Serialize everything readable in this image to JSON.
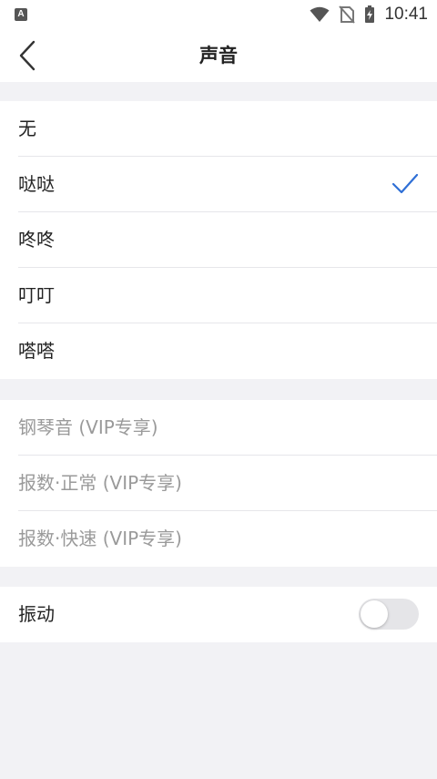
{
  "status_bar": {
    "time": "10:41",
    "icons": [
      "app-notification-icon",
      "wifi-icon",
      "no-sim-icon",
      "battery-charging-icon"
    ]
  },
  "header": {
    "title": "声音",
    "back_icon": "chevron-left-icon"
  },
  "sound_options": [
    {
      "label": "无",
      "selected": false
    },
    {
      "label": "哒哒",
      "selected": true
    },
    {
      "label": "咚咚",
      "selected": false
    },
    {
      "label": "叮叮",
      "selected": false
    },
    {
      "label": "嗒嗒",
      "selected": false
    }
  ],
  "vip_options": [
    {
      "label": "钢琴音 (VIP专享)"
    },
    {
      "label": "报数·正常 (VIP专享)"
    },
    {
      "label": "报数·快速 (VIP专享)"
    }
  ],
  "vibration": {
    "label": "振动",
    "enabled": false
  },
  "colors": {
    "accent": "#2f6fd6",
    "background": "#f2f2f5",
    "disabled_text": "#9a9a9a",
    "toggle_off": "#e5e5e8"
  }
}
